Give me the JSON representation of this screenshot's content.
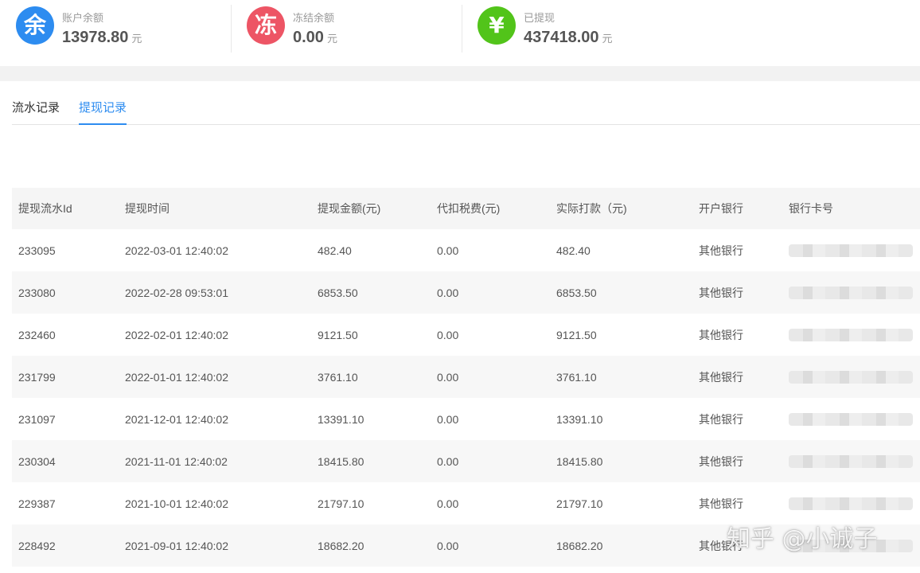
{
  "stats": [
    {
      "icon_char": "余",
      "icon": "balance-icon",
      "color": "#2d8cf0",
      "label": "账户余额",
      "value": "13978.80",
      "unit": "元"
    },
    {
      "icon_char": "冻",
      "icon": "frozen-icon",
      "color": "#ed5565",
      "label": "冻结余额",
      "value": "0.00",
      "unit": "元"
    },
    {
      "icon_char": "¥",
      "icon": "withdrawn-icon",
      "color": "#52c41a",
      "label": "已提现",
      "value": "437418.00",
      "unit": "元"
    }
  ],
  "tabs": [
    {
      "label": "流水记录",
      "active": false
    },
    {
      "label": "提现记录",
      "active": true
    }
  ],
  "table": {
    "columns": [
      "提现流水Id",
      "提现时间",
      "提现金额(元)",
      "代扣税费(元)",
      "实际打款（元)",
      "开户银行",
      "银行卡号"
    ],
    "rows": [
      [
        "233095",
        "2022-03-01 12:40:02",
        "482.40",
        "0.00",
        "482.40",
        "其他银行"
      ],
      [
        "233080",
        "2022-02-28 09:53:01",
        "6853.50",
        "0.00",
        "6853.50",
        "其他银行"
      ],
      [
        "232460",
        "2022-02-01 12:40:02",
        "9121.50",
        "0.00",
        "9121.50",
        "其他银行"
      ],
      [
        "231799",
        "2022-01-01 12:40:02",
        "3761.10",
        "0.00",
        "3761.10",
        "其他银行"
      ],
      [
        "231097",
        "2021-12-01 12:40:02",
        "13391.10",
        "0.00",
        "13391.10",
        "其他银行"
      ],
      [
        "230304",
        "2021-11-01 12:40:02",
        "18415.80",
        "0.00",
        "18415.80",
        "其他银行"
      ],
      [
        "229387",
        "2021-10-01 12:40:02",
        "21797.10",
        "0.00",
        "21797.10",
        "其他银行"
      ],
      [
        "228492",
        "2021-09-01 12:40:02",
        "18682.20",
        "0.00",
        "18682.20",
        "其他银行"
      ]
    ]
  },
  "watermark": "知乎 @小诚子"
}
